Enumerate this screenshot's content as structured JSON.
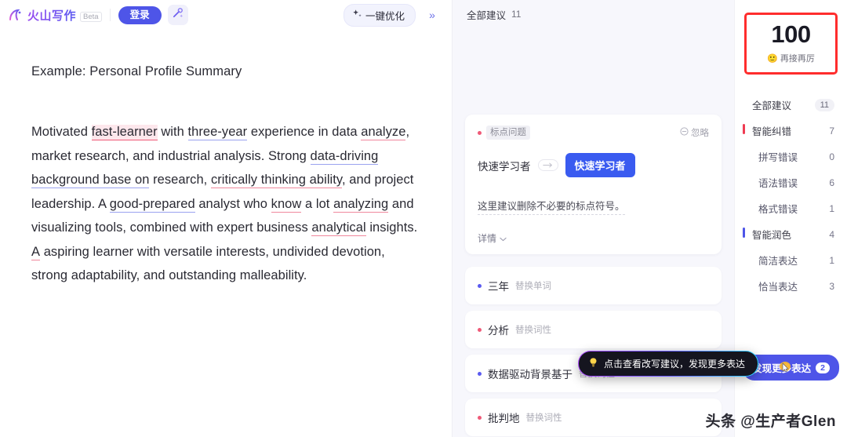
{
  "header": {
    "brand_name": "火山写作",
    "beta_label": "Beta",
    "login_label": "登录",
    "wand_icon": "magic-wand-icon",
    "optimize_label": "一键优化",
    "expand_label": "»"
  },
  "document": {
    "title": "Example: Personal Profile Summary",
    "paragraph_parts": [
      {
        "text": "Motivated ",
        "mark": "none"
      },
      {
        "text": "fast-learner",
        "mark": "red-highlight"
      },
      {
        "text": " with ",
        "mark": "none"
      },
      {
        "text": "three-year",
        "mark": "blue-underline"
      },
      {
        "text": " experience in data ",
        "mark": "none"
      },
      {
        "text": "analyze",
        "mark": "red-underline"
      },
      {
        "text": ", market research, and industrial analysis. Strong ",
        "mark": "none"
      },
      {
        "text": "data-driving background base on",
        "mark": "blue-underline"
      },
      {
        "text": " research, ",
        "mark": "none"
      },
      {
        "text": "critically thinking ability",
        "mark": "red-underline"
      },
      {
        "text": ", and project leadership. A ",
        "mark": "none"
      },
      {
        "text": "good-prepared",
        "mark": "blue-underline"
      },
      {
        "text": " analyst who ",
        "mark": "none"
      },
      {
        "text": "know",
        "mark": "red-underline"
      },
      {
        "text": " a lot ",
        "mark": "none"
      },
      {
        "text": "analyzing",
        "mark": "red-underline"
      },
      {
        "text": " and visualizing tools, combined with expert business ",
        "mark": "none"
      },
      {
        "text": "analytical",
        "mark": "red-underline"
      },
      {
        "text": " insights. ",
        "mark": "none"
      },
      {
        "text": "A",
        "mark": "red-underline"
      },
      {
        "text": " aspiring learner with versatile interests, undivided devotion, strong adaptability, and outstanding malleability.",
        "mark": "none"
      }
    ]
  },
  "suggestions": {
    "header_label": "全部建议",
    "header_count": "11",
    "card": {
      "tag": "标点问题",
      "ignore_label": "忽略",
      "ignore_icon": "circle-minus-icon",
      "original": "快速学习者",
      "arrow_icon": "arrow-right-icon",
      "replacement": "快速学习者",
      "description": "这里建议删除不必要的标点符号。",
      "detail_label": "详情",
      "detail_icon": "chevron-down-icon"
    },
    "rows": [
      {
        "word": "三年",
        "kind": "替换单词",
        "dot": "blue"
      },
      {
        "word": "分析",
        "kind": "替换词性",
        "dot": "red"
      },
      {
        "word": "数据驱动背景基于",
        "kind": "替换词性",
        "dot": "blue"
      },
      {
        "word": "批判地",
        "kind": "替换词性",
        "dot": "red"
      }
    ],
    "tooltip": {
      "icon": "lightbulb-icon",
      "text": "点击查看改写建议，发现更多表达"
    }
  },
  "sidebar": {
    "score": "100",
    "score_emoji": "🙂",
    "score_caption": "再接再厉",
    "items": [
      {
        "label": "全部建议",
        "count": "11",
        "type": "pill",
        "indent": "group",
        "bar": ""
      },
      {
        "label": "智能纠错",
        "count": "7",
        "type": "num",
        "indent": "group",
        "bar": "red"
      },
      {
        "label": "拼写错误",
        "count": "0",
        "type": "num",
        "indent": "sub",
        "bar": ""
      },
      {
        "label": "语法错误",
        "count": "6",
        "type": "num",
        "indent": "sub",
        "bar": ""
      },
      {
        "label": "格式错误",
        "count": "1",
        "type": "num",
        "indent": "sub",
        "bar": ""
      },
      {
        "label": "智能润色",
        "count": "4",
        "type": "num",
        "indent": "group",
        "bar": "blue"
      },
      {
        "label": "简洁表达",
        "count": "1",
        "type": "num",
        "indent": "sub",
        "bar": ""
      },
      {
        "label": "恰当表达",
        "count": "3",
        "type": "num",
        "indent": "sub",
        "bar": ""
      }
    ],
    "more_button": {
      "label": "发现更多表达",
      "count": "2",
      "cursor_icon": "pointer-cursor-icon"
    }
  },
  "watermark": "头条 @生产者Glen",
  "colors": {
    "brand_purple": "#9a4df0",
    "primary_blue": "#4e55e8",
    "replace_blue": "#3a5bf0",
    "error_red": "#ef3b52",
    "highlight_pink": "#fde7ec",
    "score_box_red": "#ff2d2d",
    "panel_bg": "#f7f7fc"
  }
}
